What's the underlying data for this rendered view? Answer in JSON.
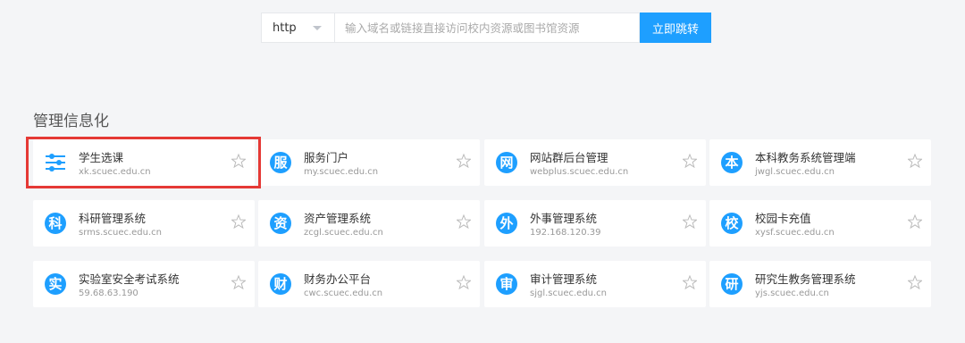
{
  "search": {
    "protocol": "http",
    "placeholder": "输入域名或链接直接访问校内资源或图书馆资源",
    "submit_label": "立即跳转"
  },
  "section": {
    "title": "管理信息化"
  },
  "colors": {
    "accent": "#1e9fff",
    "highlight": "#e53935"
  },
  "cards": [
    {
      "icon": "sliders-icon",
      "glyph": "",
      "name": "学生选课",
      "domain": "xk.scuec.edu.cn"
    },
    {
      "icon": "service-icon",
      "glyph": "服",
      "name": "服务门户",
      "domain": "my.scuec.edu.cn"
    },
    {
      "icon": "network-icon",
      "glyph": "网",
      "name": "网站群后台管理",
      "domain": "webplus.scuec.edu.cn"
    },
    {
      "icon": "undergrad-icon",
      "glyph": "本",
      "name": "本科教务系统管理端",
      "domain": "jwgl.scuec.edu.cn"
    },
    {
      "icon": "research-icon",
      "glyph": "科",
      "name": "科研管理系统",
      "domain": "srms.scuec.edu.cn"
    },
    {
      "icon": "asset-icon",
      "glyph": "资",
      "name": "资产管理系统",
      "domain": "zcgl.scuec.edu.cn"
    },
    {
      "icon": "foreign-icon",
      "glyph": "外",
      "name": "外事管理系统",
      "domain": "192.168.120.39"
    },
    {
      "icon": "campus-card-icon",
      "glyph": "校",
      "name": "校园卡充值",
      "domain": "xysf.scuec.edu.cn"
    },
    {
      "icon": "lab-icon",
      "glyph": "实",
      "name": "实验室安全考试系统",
      "domain": "59.68.63.190"
    },
    {
      "icon": "finance-icon",
      "glyph": "财",
      "name": "财务办公平台",
      "domain": "cwc.scuec.edu.cn"
    },
    {
      "icon": "audit-icon",
      "glyph": "审",
      "name": "审计管理系统",
      "domain": "sjgl.scuec.edu.cn"
    },
    {
      "icon": "graduate-icon",
      "glyph": "研",
      "name": "研究生教务管理系统",
      "domain": "yjs.scuec.edu.cn"
    }
  ]
}
